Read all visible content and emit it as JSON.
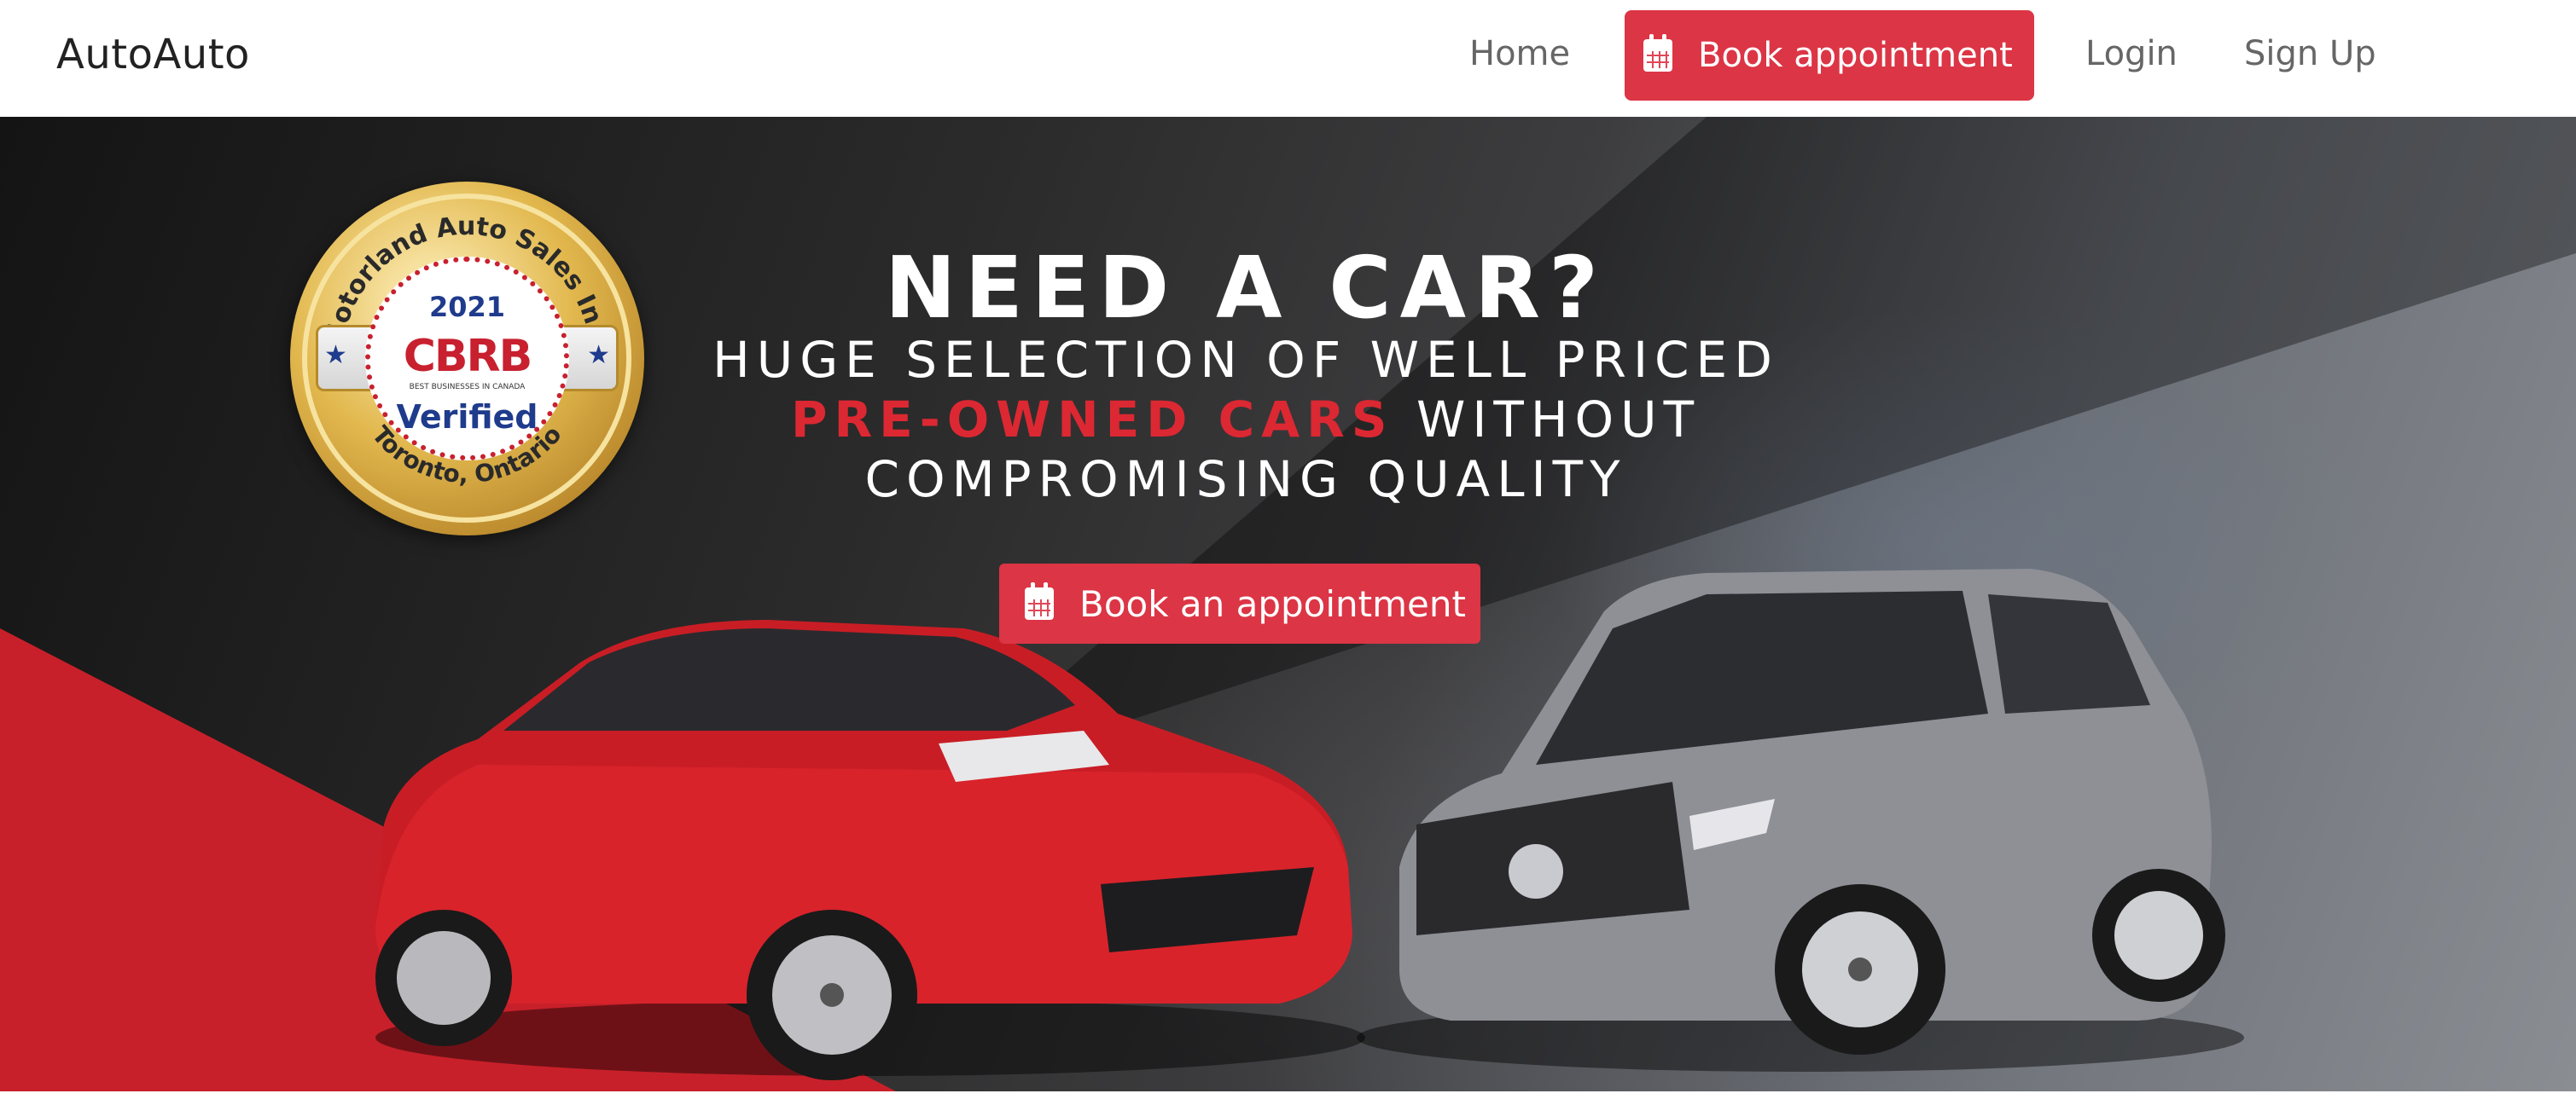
{
  "navbar": {
    "brand": "AutoAuto",
    "links": {
      "home": "Home",
      "book_appointment": "Book appointment",
      "login": "Login",
      "signup": "Sign Up"
    },
    "book_icon": "calendar-icon"
  },
  "hero": {
    "badge": {
      "top_text": "Motorland Auto Sales Inc.",
      "year": "2021",
      "logo_text": "CBRB",
      "tagline": "BEST BUSINESSES IN CANADA",
      "verified": "Verified",
      "bottom_text": "Toronto, Ontario"
    },
    "headline": "NEED A CAR?",
    "subline_1": "HUGE SELECTION OF WELL PRICED",
    "subline_2_highlight": "PRE-OWNED CARS",
    "subline_2_rest": " WITHOUT",
    "subline_3": "COMPROMISING QUALITY",
    "cta_label": "Book an appointment",
    "cta_icon": "calendar-icon"
  },
  "colors": {
    "accent_red": "#dc3545",
    "highlight_red": "#dc2832",
    "nav_text": "#666666"
  }
}
